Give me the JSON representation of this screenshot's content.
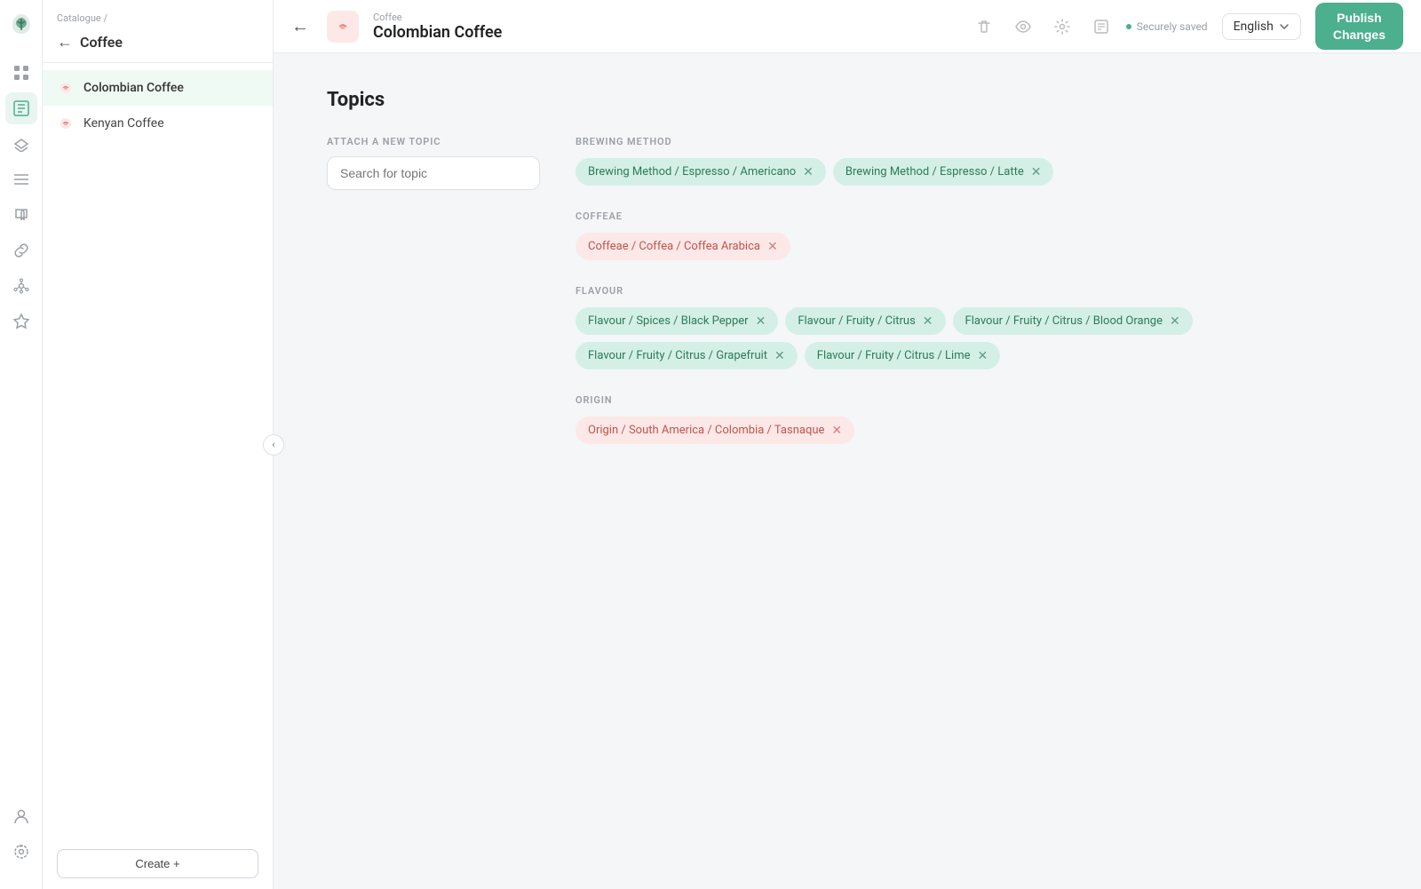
{
  "app": {
    "logo_char": "🌿",
    "title": "Catalogue Coffee"
  },
  "breadcrumb": {
    "parent": "Catalogue",
    "child": "Coffee"
  },
  "sidebar": {
    "back_label": "Coffee",
    "items": [
      {
        "id": "colombian-coffee",
        "label": "Colombian Coffee",
        "active": true
      },
      {
        "id": "kenyan-coffee",
        "label": "Kenyan Coffee",
        "active": false
      }
    ],
    "create_label": "Create +"
  },
  "topbar": {
    "parent_label": "Coffee",
    "title": "Colombian Coffee",
    "saved_label": "Securely saved",
    "lang": "English",
    "publish_line1": "Publish",
    "publish_line2": "Changes"
  },
  "content": {
    "section_title": "Topics",
    "attach_label": "ATTACH A NEW TOPIC",
    "search_placeholder": "Search for topic",
    "groups": [
      {
        "id": "brewing-method",
        "label": "BREWING METHOD",
        "color": "green",
        "tags": [
          "Brewing Method / Espresso / Americano",
          "Brewing Method / Espresso / Latte"
        ]
      },
      {
        "id": "coffeae",
        "label": "COFFEAE",
        "color": "pink",
        "tags": [
          "Coffeae / Coffea / Coffea Arabica"
        ]
      },
      {
        "id": "flavour",
        "label": "FLAVOUR",
        "color": "green",
        "tags": [
          "Flavour / Spices / Black Pepper",
          "Flavour / Fruity / Citrus",
          "Flavour / Fruity / Citrus / Blood Orange",
          "Flavour / Fruity / Citrus / Grapefruit",
          "Flavour / Fruity / Citrus / Lime"
        ]
      },
      {
        "id": "origin",
        "label": "ORIGIN",
        "color": "pink",
        "tags": [
          "Origin / South America / Colombia / Tasnaque"
        ]
      }
    ]
  },
  "icons": {
    "rail": [
      "grid-icon",
      "layers-icon",
      "list-icon",
      "book-icon",
      "link-icon",
      "hub-icon",
      "star-icon"
    ],
    "rail_bottom": [
      "user-icon",
      "settings-icon"
    ],
    "topbar_actions": [
      "trash-icon",
      "eye-icon",
      "settings-icon",
      "notes-icon"
    ]
  }
}
